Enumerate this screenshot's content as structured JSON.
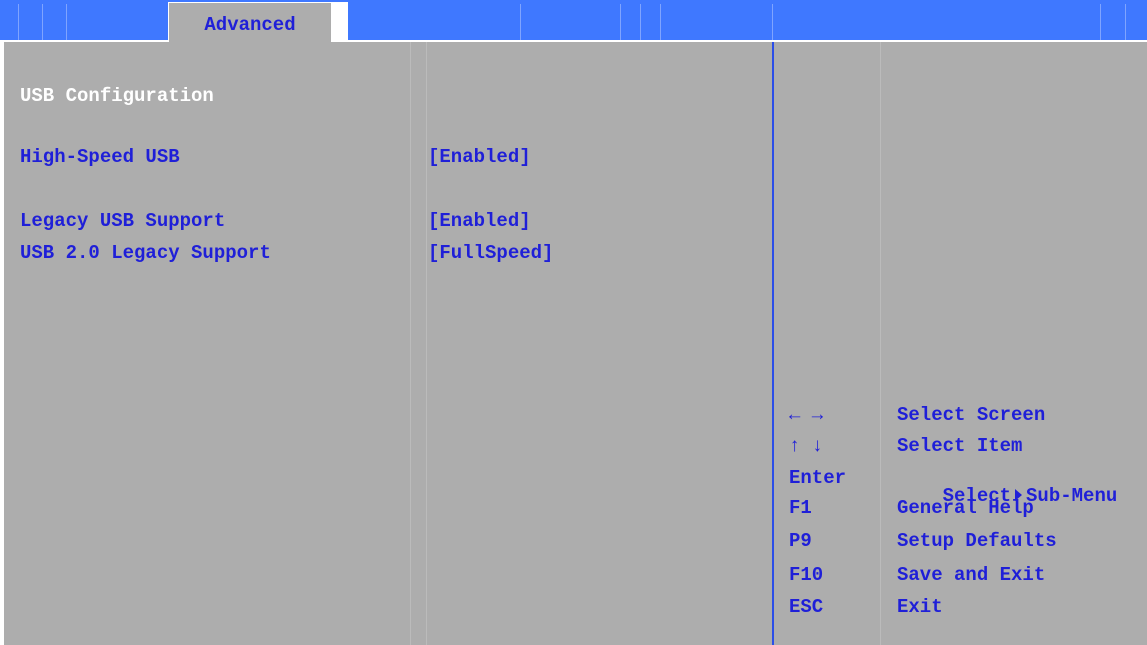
{
  "tabs": [
    {
      "label": "Advanced",
      "active": true
    }
  ],
  "main": {
    "section_title": "USB Configuration",
    "settings": [
      {
        "label": "High-Speed USB",
        "value": "[Enabled]"
      },
      {
        "label": "Legacy USB Support",
        "value": "[Enabled]"
      },
      {
        "label": "USB 2.0 Legacy Support",
        "value": "[FullSpeed]"
      }
    ]
  },
  "help": {
    "keys": [
      {
        "key": "← →",
        "desc": "Select Screen"
      },
      {
        "key": "↑ ↓",
        "desc": "Select Item"
      },
      {
        "key": "Enter",
        "desc_prefix": "Select",
        "desc_suffix": "Sub-Menu"
      },
      {
        "key": "F1",
        "desc": "General Help"
      },
      {
        "key": "P9",
        "desc": "Setup Defaults"
      },
      {
        "key": "F10",
        "desc": "Save and Exit"
      },
      {
        "key": "ESC",
        "desc": "Exit"
      }
    ]
  },
  "colors": {
    "header_bg": "#3f78ff",
    "panel_bg": "#adadad",
    "text_blue": "#1f1fd8",
    "text_white": "#ffffff"
  },
  "icons": [
    "left-arrow-icon",
    "right-arrow-icon",
    "up-arrow-icon",
    "down-arrow-icon",
    "submenu-triangle-icon"
  ]
}
